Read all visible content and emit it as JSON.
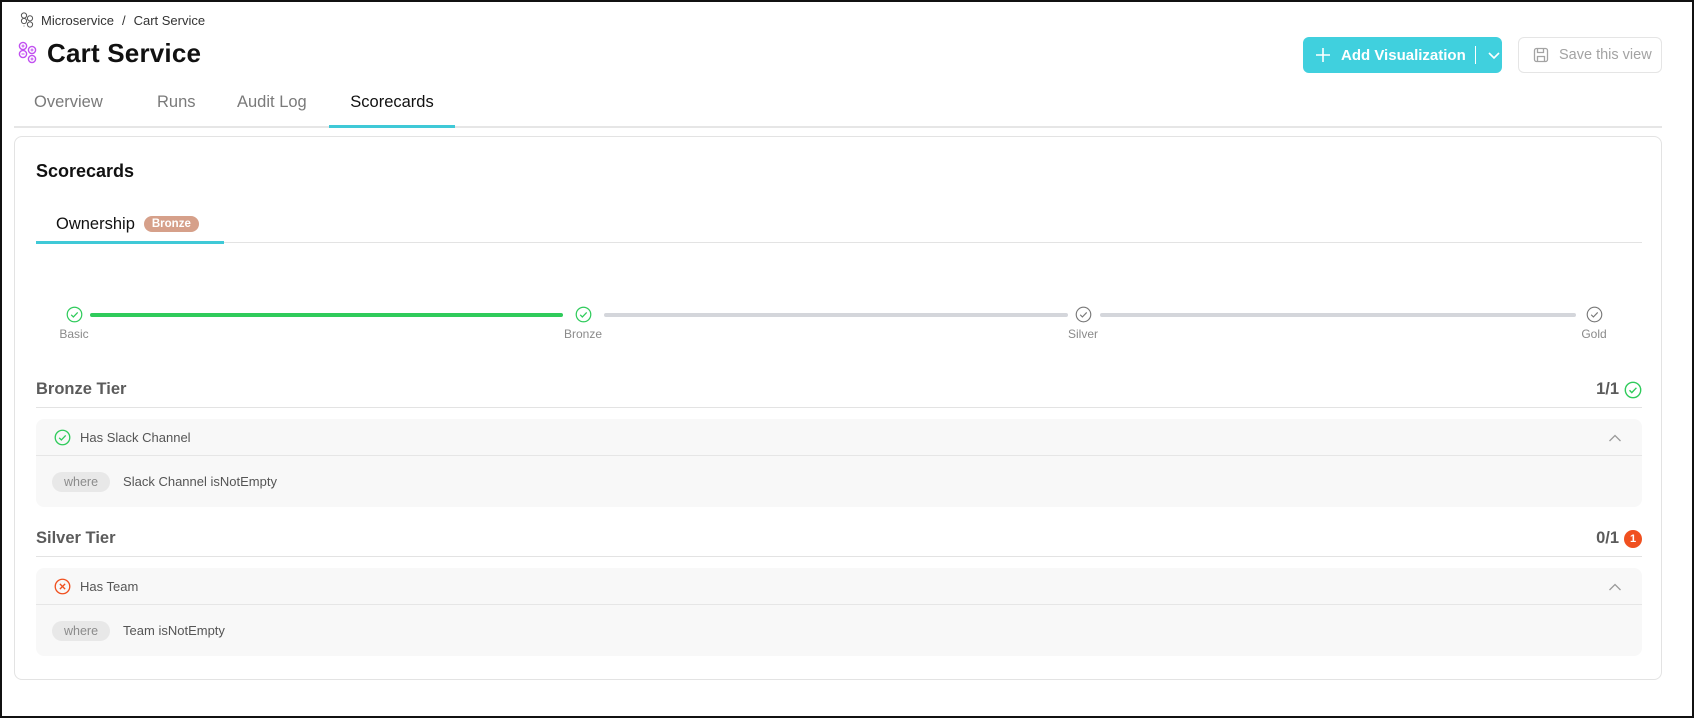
{
  "breadcrumb": {
    "icon": "microservice-icon",
    "parent": "Microservice",
    "separator": "/",
    "current": "Cart Service"
  },
  "header": {
    "icon": "microservice-icon",
    "title": "Cart Service",
    "add_visualization_label": "Add Visualization",
    "save_view_label": "Save this view"
  },
  "tabs": [
    {
      "label": "Overview",
      "active": false
    },
    {
      "label": "Runs",
      "active": false
    },
    {
      "label": "Audit Log",
      "active": false
    },
    {
      "label": "Scorecards",
      "active": true
    }
  ],
  "scorecards": {
    "title": "Scorecards",
    "tabs": [
      {
        "label": "Ownership",
        "badge": "Bronze",
        "badge_color": "#d6a08a",
        "active": true
      }
    ],
    "progress": {
      "levels": [
        {
          "label": "Basic",
          "achieved": true
        },
        {
          "label": "Bronze",
          "achieved": true
        },
        {
          "label": "Silver",
          "achieved": false
        },
        {
          "label": "Gold",
          "achieved": false
        }
      ],
      "achieved_color": "#2fcb5b",
      "pending_color": "#d4d6db"
    },
    "tiers": [
      {
        "name": "Bronze Tier",
        "score": "1/1",
        "status": "passed",
        "rules": [
          {
            "title": "Has Slack Channel",
            "status": "passed",
            "where": "where",
            "condition": "Slack Channel isNotEmpty"
          }
        ]
      },
      {
        "name": "Silver Tier",
        "score": "0/1",
        "status": "failed",
        "failed_count": "1",
        "rules": [
          {
            "title": "Has Team",
            "status": "failed",
            "where": "where",
            "condition": "Team isNotEmpty"
          }
        ]
      }
    ]
  },
  "colors": {
    "accent": "#40d0de",
    "tab_underline": "#3fc9d7",
    "success": "#2fcb5b",
    "error": "#f0501f",
    "icon_purple": "#c14ff0"
  }
}
